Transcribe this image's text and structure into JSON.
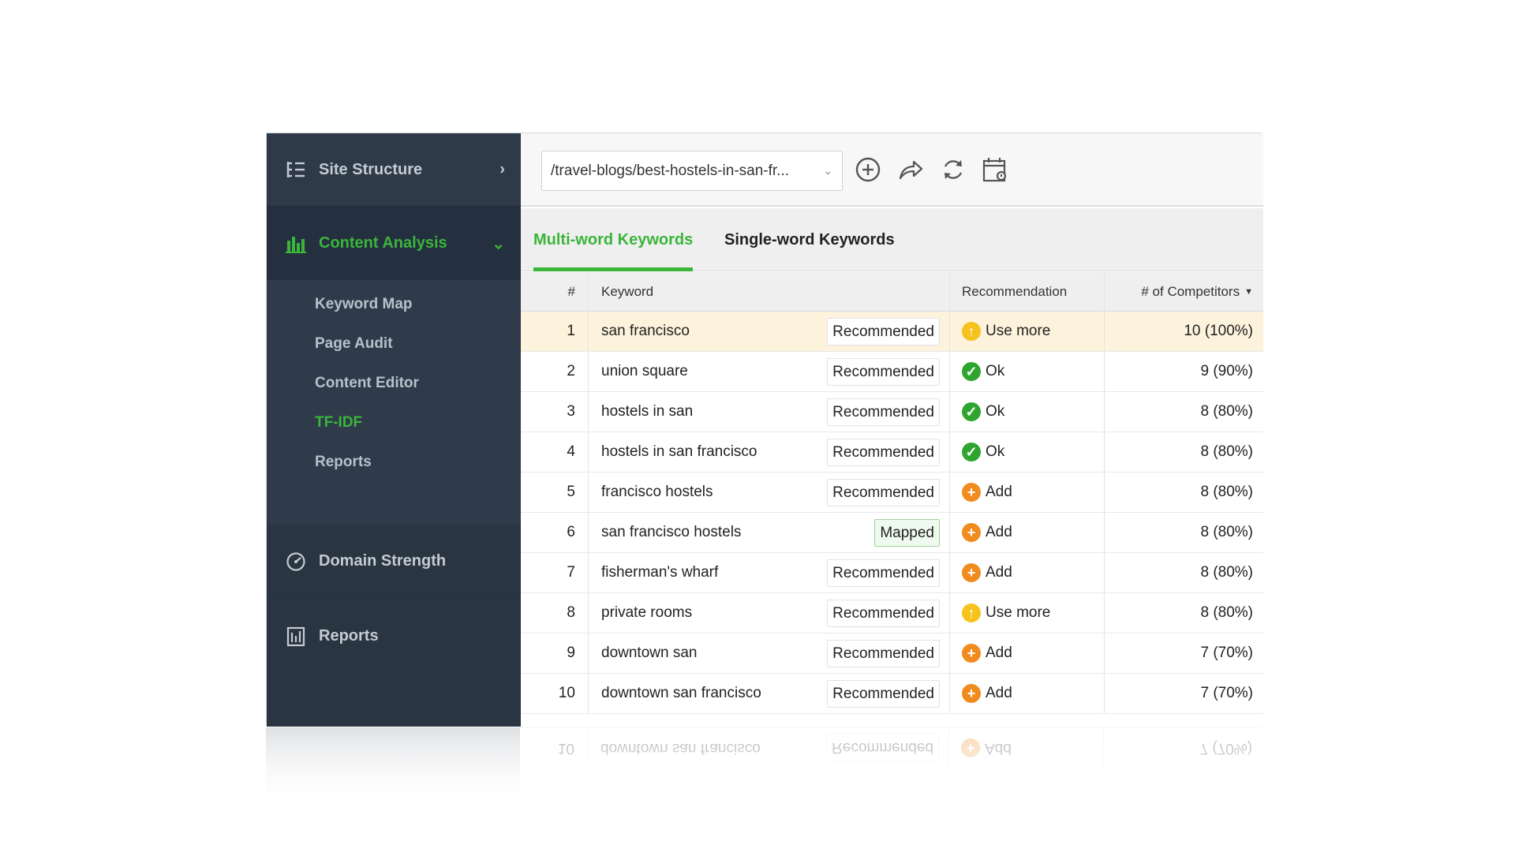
{
  "sidebar": {
    "site_structure": "Site Structure",
    "content_analysis": "Content Analysis",
    "sub_items": [
      "Keyword Map",
      "Page Audit",
      "Content Editor",
      "TF-IDF",
      "Reports"
    ],
    "domain_strength": "Domain Strength",
    "reports": "Reports"
  },
  "toolbar": {
    "url_value": "/travel-blogs/best-hostels-in-san-fr...",
    "icons": [
      "add-circle-icon",
      "share-icon",
      "refresh-icon",
      "schedule-icon"
    ]
  },
  "tabs": {
    "multi": "Multi-word Keywords",
    "single": "Single-word Keywords"
  },
  "table": {
    "headers": {
      "num": "#",
      "keyword": "Keyword",
      "recommendation": "Recommendation",
      "competitors": "# of Competitors"
    },
    "rows": [
      {
        "num": "1",
        "keyword": "san francisco",
        "badge": "Recommended",
        "rec": "Use more",
        "rec_type": "usemore",
        "competitors": "10 (100%)"
      },
      {
        "num": "2",
        "keyword": "union square",
        "badge": "Recommended",
        "rec": "Ok",
        "rec_type": "ok",
        "competitors": "9 (90%)"
      },
      {
        "num": "3",
        "keyword": "hostels in san",
        "badge": "Recommended",
        "rec": "Ok",
        "rec_type": "ok",
        "competitors": "8 (80%)"
      },
      {
        "num": "4",
        "keyword": "hostels in san francisco",
        "badge": "Recommended",
        "rec": "Ok",
        "rec_type": "ok",
        "competitors": "8 (80%)"
      },
      {
        "num": "5",
        "keyword": "francisco hostels",
        "badge": "Recommended",
        "rec": "Add",
        "rec_type": "add",
        "competitors": "8 (80%)"
      },
      {
        "num": "6",
        "keyword": "san francisco hostels",
        "badge": "Mapped",
        "rec": "Add",
        "rec_type": "add",
        "competitors": "8 (80%)"
      },
      {
        "num": "7",
        "keyword": "fisherman's wharf",
        "badge": "Recommended",
        "rec": "Add",
        "rec_type": "add",
        "competitors": "8 (80%)"
      },
      {
        "num": "8",
        "keyword": "private rooms",
        "badge": "Recommended",
        "rec": "Use more",
        "rec_type": "usemore",
        "competitors": "8 (80%)"
      },
      {
        "num": "9",
        "keyword": "downtown san",
        "badge": "Recommended",
        "rec": "Add",
        "rec_type": "add",
        "competitors": "7 (70%)"
      },
      {
        "num": "10",
        "keyword": "downtown san francisco",
        "badge": "Recommended",
        "rec": "Add",
        "rec_type": "add",
        "competitors": "7 (70%)"
      }
    ]
  },
  "colors": {
    "accent": "#3ab53a",
    "sidebar_bg": "#2a3542",
    "highlight_row": "#fdf3dc",
    "use_more": "#f6c21c",
    "ok": "#2ea52e",
    "add": "#f08c1f"
  }
}
